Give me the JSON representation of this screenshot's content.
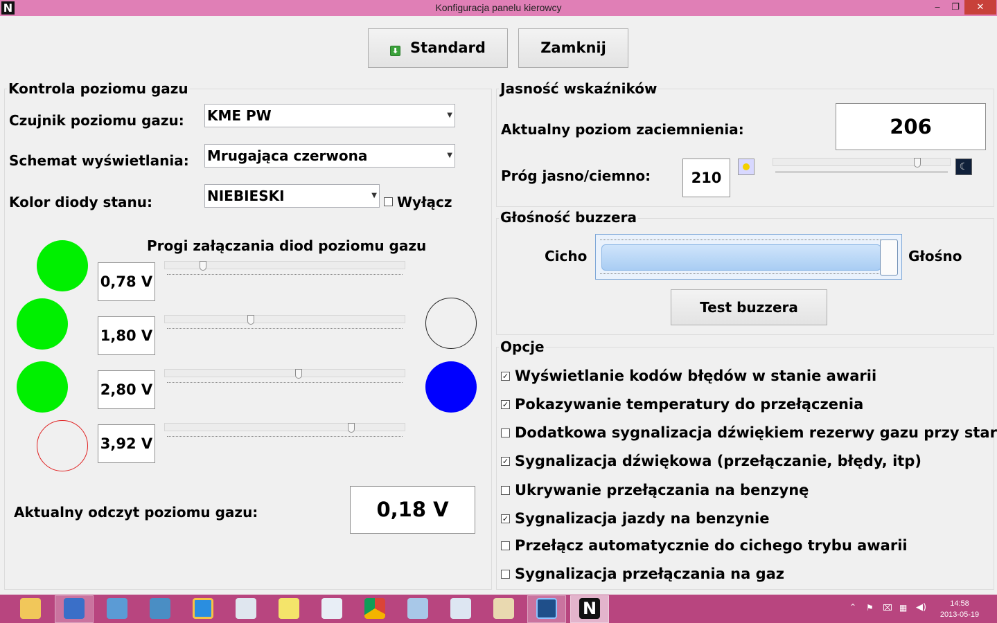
{
  "window": {
    "title": "Konfiguracja panelu kierowcy",
    "logo": "N",
    "min": "‒",
    "restore": "❐",
    "close": "✕"
  },
  "toolbar": {
    "standard_label": "Standard",
    "close_label": "Zamknij"
  },
  "gas": {
    "title": "Kontrola poziomu gazu",
    "sensor_label": "Czujnik poziomu gazu:",
    "sensor_value": "KME PW",
    "scheme_label": "Schemat wyświetlania:",
    "scheme_value": "Mrugająca czerwona",
    "led_color_label": "Kolor diody stanu:",
    "led_color_value": "NIEBIESKI",
    "disable_label": "Wyłącz",
    "disable_checked": false,
    "thresholds_title": "Progi załączania diod poziomu gazu",
    "thresholds": [
      {
        "value": "0,78 V",
        "led_color": "#00f000",
        "slider_level": 0.16
      },
      {
        "value": "1,80 V",
        "led_color": "#00f000",
        "slider_level": 0.36
      },
      {
        "value": "2,80 V",
        "led_color": "#00f000",
        "slider_level": 0.56
      },
      {
        "value": "3,92 V",
        "led_color": "#f0f0f0",
        "slider_level": 0.78
      }
    ],
    "status_leds": [
      "#f0f0f0",
      "#0000ff"
    ],
    "current_label": "Aktualny odczyt poziomu gazu:",
    "current_value": "0,18 V"
  },
  "brightness": {
    "title": "Jasność wskaźników",
    "dim_label": "Aktualny poziom zaciemnienia:",
    "dim_value": "206",
    "threshold_label": "Próg jasno/ciemno:",
    "threshold_value": "210",
    "slider_level": 0.82
  },
  "buzzer": {
    "title": "Głośność buzzera",
    "quiet_label": "Cicho",
    "loud_label": "Głośno",
    "volume_level": 1.0,
    "test_label": "Test buzzera"
  },
  "options": {
    "title": "Opcje",
    "items": [
      {
        "label": "Wyświetlanie kodów błędów w stanie awarii",
        "checked": true
      },
      {
        "label": "Pokazywanie temperatury do przełączenia",
        "checked": true
      },
      {
        "label": "Dodatkowa sygnalizacja dźwiękiem rezerwy gazu przy starcie",
        "checked": false
      },
      {
        "label": "Sygnalizacja dźwiękowa (przełączanie, błędy, itp)",
        "checked": true
      },
      {
        "label": "Ukrywanie przełączania na benzynę",
        "checked": false
      },
      {
        "label": "Sygnalizacja jazdy na benzynie",
        "checked": true
      },
      {
        "label": "Przełącz automatycznie do cichego trybu awarii",
        "checked": false
      },
      {
        "label": "Sygnalizacja przełączania na gaz",
        "checked": false
      }
    ]
  },
  "taskbar": {
    "apps": [
      "file-explorer-icon",
      "computer-icon",
      "window-icon",
      "control-panel-icon",
      "internet-explorer-icon",
      "calculator-icon",
      "sticky-notes-icon",
      "sketch-icon",
      "chrome-icon",
      "notepad-icon",
      "wordpad-icon",
      "paint-icon",
      "app-circle-icon",
      "n-app-icon"
    ],
    "time": "14:58",
    "date": "2013-05-19"
  }
}
